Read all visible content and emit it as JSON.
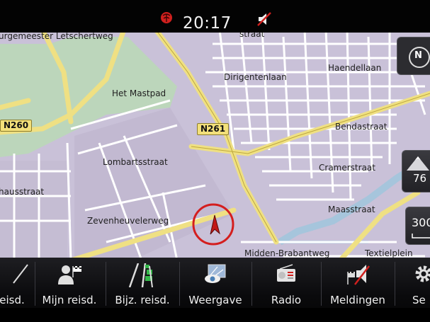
{
  "status_bar": {
    "clock": "20:17",
    "icons": [
      "gps-signal-icon",
      "mute-icon"
    ]
  },
  "map": {
    "street_labels": [
      "urgemeester Letschertweg",
      "straat",
      "Dirigentenlaan",
      "Haendellaan",
      "Het Mastpad",
      "Bendastraat",
      "Lombartsstraat",
      "Cramerstraat",
      "hausstraat",
      "Maasstraat",
      "Zevenheuvelerweg",
      "Midden-Brabantweg",
      "Textielplein"
    ],
    "road_badges": [
      "N260",
      "N261"
    ]
  },
  "controls": {
    "compass_label": "N",
    "altitude_value": "76",
    "scale_value": "300"
  },
  "bottom_tabs": [
    {
      "label": "eisd.",
      "icon": "route-flag-icon"
    },
    {
      "label": "Mijn reisd.",
      "icon": "my-destinations-icon"
    },
    {
      "label": "Bijz. reisd.",
      "icon": "special-destinations-icon"
    },
    {
      "label": "Weergave",
      "icon": "view-eye-map-icon"
    },
    {
      "label": "Radio",
      "icon": "radio-icon"
    },
    {
      "label": "Meldingen",
      "icon": "notifications-icon"
    },
    {
      "label": "Se",
      "icon": "settings-gear-icon"
    }
  ],
  "colors": {
    "map_land": "#c7bfd6",
    "map_green": "#b9d4b8",
    "map_water": "#9fc3d9",
    "major_road": "#efe083",
    "minor_road": "#ffffff",
    "marker_red": "#d41e1e",
    "panel_dark": "#0a0a0c"
  }
}
